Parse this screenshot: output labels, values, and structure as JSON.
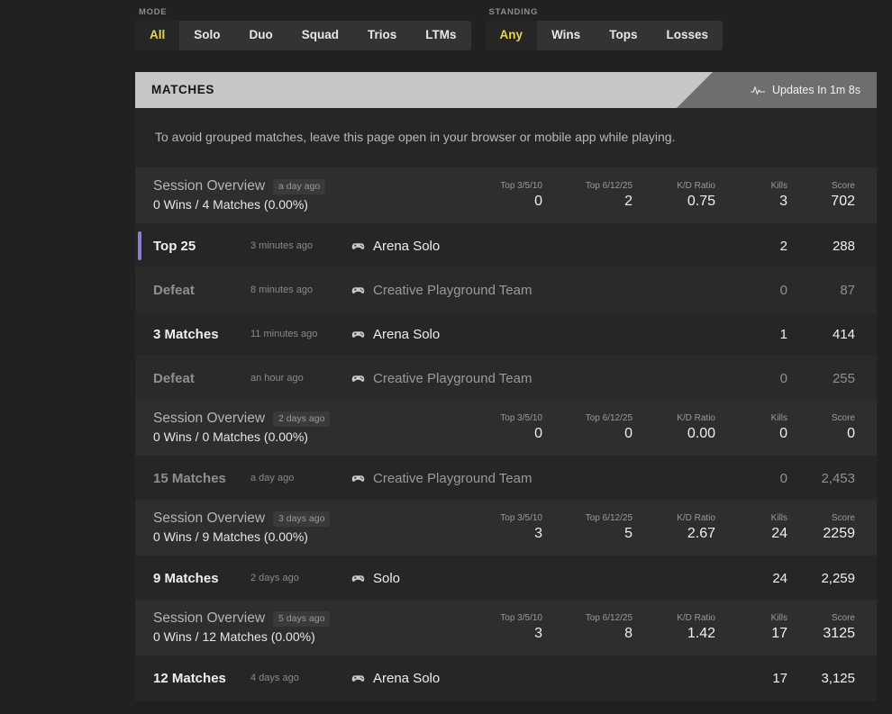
{
  "filters": {
    "groups": [
      {
        "label": "MODE",
        "name": "mode",
        "options": [
          "All",
          "Solo",
          "Duo",
          "Squad",
          "Trios",
          "LTMs"
        ],
        "selected": "All"
      },
      {
        "label": "STANDING",
        "name": "standing",
        "options": [
          "Any",
          "Wins",
          "Tops",
          "Losses"
        ],
        "selected": "Any"
      }
    ]
  },
  "panel": {
    "title": "MATCHES",
    "update_text": "Updates In 1m 8s",
    "update_icon": "pulse-icon",
    "notice": "To avoid grouped matches, leave this page open in your browser or mobile app while playing.",
    "accent_color": "#8b7fd4",
    "header_bg": "#c6c6c6",
    "highlight_color": "#e8d44d"
  },
  "stat_headers": [
    "Top 3/5/10",
    "Top 6/12/25",
    "K/D Ratio",
    "Kills",
    "Score"
  ],
  "sessions": [
    {
      "title": "Session Overview",
      "time": "a day ago",
      "summary": "0 Wins / 4 Matches (0.00%)",
      "stats": [
        "0",
        "2",
        "0.75",
        "3",
        "702"
      ],
      "matches": [
        {
          "result": "Top 25",
          "time": "3 minutes ago",
          "mode": "Arena Solo",
          "mode_icon": "gamepad-icon",
          "kills": "2",
          "score": "288",
          "accent": true,
          "dim": false
        },
        {
          "result": "Defeat",
          "time": "8 minutes ago",
          "mode": "Creative Playground Team",
          "mode_icon": "gamepad-icon",
          "kills": "0",
          "score": "87",
          "accent": false,
          "dim": true
        },
        {
          "result": "3 Matches",
          "time": "11 minutes ago",
          "mode": "Arena Solo",
          "mode_icon": "gamepad-icon",
          "kills": "1",
          "score": "414",
          "accent": false,
          "dim": false
        },
        {
          "result": "Defeat",
          "time": "an hour ago",
          "mode": "Creative Playground Team",
          "mode_icon": "gamepad-icon",
          "kills": "0",
          "score": "255",
          "accent": false,
          "dim": true
        }
      ]
    },
    {
      "title": "Session Overview",
      "time": "2 days ago",
      "summary": "0 Wins / 0 Matches (0.00%)",
      "stats": [
        "0",
        "0",
        "0.00",
        "0",
        "0"
      ],
      "matches": [
        {
          "result": "15 Matches",
          "time": "a day ago",
          "mode": "Creative Playground Team",
          "mode_icon": "gamepad-icon",
          "kills": "0",
          "score": "2,453",
          "accent": false,
          "dim": true
        }
      ]
    },
    {
      "title": "Session Overview",
      "time": "3 days ago",
      "summary": "0 Wins / 9 Matches (0.00%)",
      "stats": [
        "3",
        "5",
        "2.67",
        "24",
        "2259"
      ],
      "matches": [
        {
          "result": "9 Matches",
          "time": "2 days ago",
          "mode": "Solo",
          "mode_icon": "gamepad-icon",
          "kills": "24",
          "score": "2,259",
          "accent": false,
          "dim": false
        }
      ]
    },
    {
      "title": "Session Overview",
      "time": "5 days ago",
      "summary": "0 Wins / 12 Matches (0.00%)",
      "stats": [
        "3",
        "8",
        "1.42",
        "17",
        "3125"
      ],
      "matches": [
        {
          "result": "12 Matches",
          "time": "4 days ago",
          "mode": "Arena Solo",
          "mode_icon": "gamepad-icon",
          "kills": "17",
          "score": "3,125",
          "accent": false,
          "dim": false
        }
      ]
    }
  ]
}
